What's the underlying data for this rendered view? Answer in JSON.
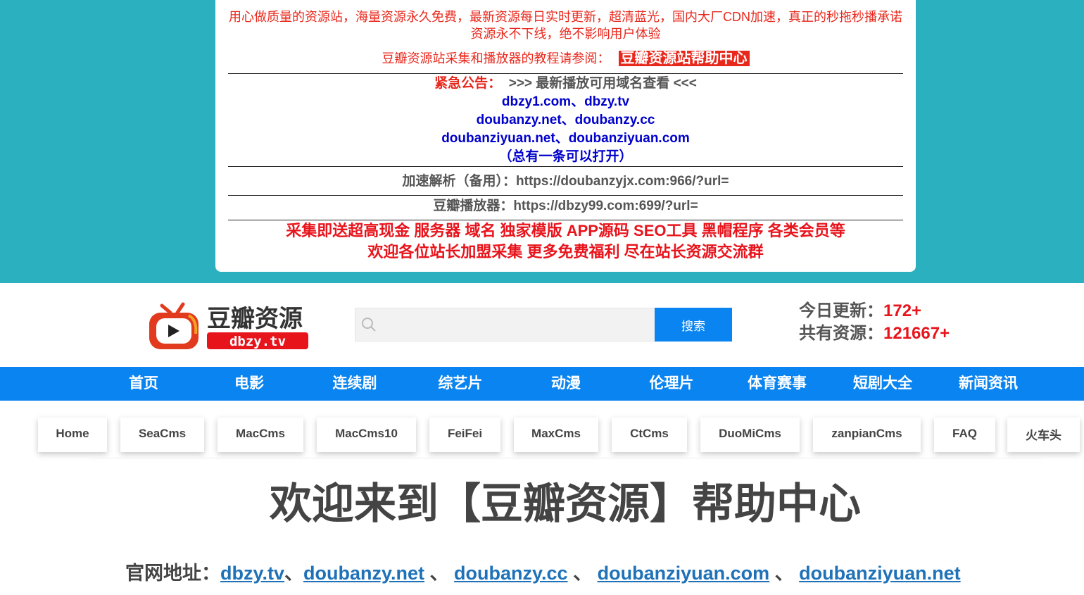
{
  "notice": {
    "line1": "用心做质量的资源站，海量资源永久免费，最新资源每日实时更新，超清蓝光，国内大厂CDN加速，真正的秒拖秒播承诺资源永不下线，绝不影响用户体验",
    "line2_text": "豆瓣资源站采集和播放器的教程请参阅：",
    "line2_link": "豆瓣资源站帮助中心",
    "urgent_label": "紧急公告：",
    "urgent_text": ">>> 最新播放可用域名查看 <<<",
    "domains": [
      "dbzy1.com、dbzy.tv",
      "doubanzy.net、doubanzy.cc",
      "doubanziyuan.net、doubanziyuan.com"
    ],
    "domain_note": "（总有一条可以打开）",
    "parse_line": "加速解析（备用）：https://doubanzyjx.com:966/?url=",
    "player_line": "豆瓣播放器：https://dbzy99.com:699/?url=",
    "promo1": "采集即送超高现金 服务器 域名 独家模版 APP源码 SEO工具 黑帽程序 各类会员等",
    "promo2": "欢迎各位站长加盟采集 更多免费福利 尽在站长资源交流群"
  },
  "header": {
    "logo_text": "豆瓣资源",
    "logo_sub": "dbzy.tv",
    "search_placeholder": "",
    "search_button": "搜索",
    "today_label": "今日更新：",
    "today_value": "172+",
    "total_label": "共有资源：",
    "total_value": "121667+"
  },
  "nav": [
    "首页",
    "电影",
    "连续剧",
    "综艺片",
    "动漫",
    "伦理片",
    "体育赛事",
    "短剧大全",
    "新闻资讯"
  ],
  "tabs": [
    "Home",
    "SeaCms",
    "MacCms",
    "MacCms10",
    "FeiFei",
    "MaxCms",
    "CtCms",
    "DuoMiCms",
    "zanpianCms",
    "FAQ",
    "火车头"
  ],
  "main": {
    "title": "欢迎来到【豆瓣资源】帮助中心",
    "official_label": "官网地址：",
    "official_links": [
      "dbzy.tv",
      "doubanzy.net",
      "doubanzy.cc",
      "doubanziyuan.com",
      "doubanziyuan.net"
    ],
    "sep1": "、",
    "sep2": " 、",
    "sep3": " 、",
    "sep4": " 、"
  },
  "colors": {
    "teal": "#2bb0bf",
    "blue": "#0a84f0",
    "red": "#e8141c",
    "link": "#1f72b8"
  }
}
